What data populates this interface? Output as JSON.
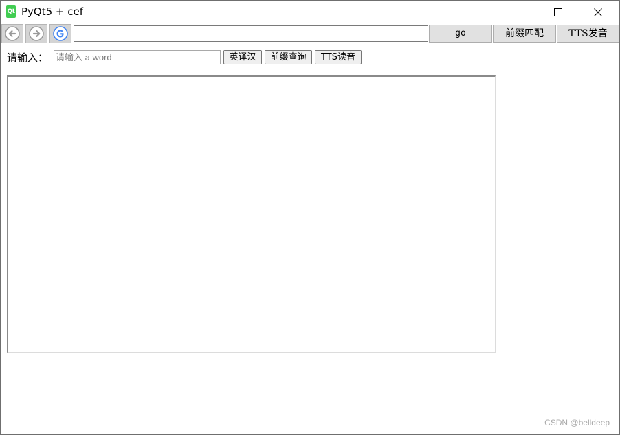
{
  "window": {
    "title": "PyQt5 + cef",
    "icon_label": "Qt"
  },
  "toolbar": {
    "back_icon": "arrow-left-circle",
    "forward_icon": "arrow-right-circle",
    "home_icon": "google-g",
    "url_value": "",
    "go_label": "go",
    "prefix_match_label": "前缀匹配",
    "tts_label": "TTS发音"
  },
  "page": {
    "prompt_label": "请输入：",
    "input_placeholder": "请输入 a word",
    "input_value": "",
    "translate_button": "英译汉",
    "prefix_query_button": "前缀查询",
    "tts_read_button": "TTS读音",
    "result_text": ""
  },
  "watermark": "CSDN @belldeep",
  "colors": {
    "nav_button_bg": "#d4d4d4",
    "nav_icon": "#9a9a9a",
    "google_blue": "#4285f4"
  }
}
